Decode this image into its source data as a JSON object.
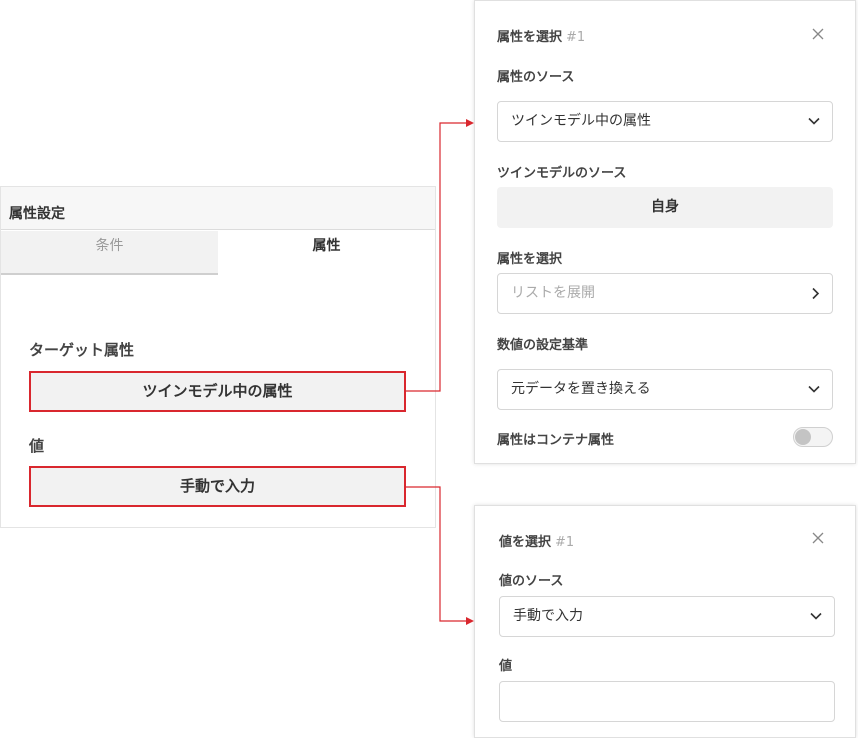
{
  "left": {
    "header": "属性設定",
    "tabs": [
      {
        "label": "条件",
        "active": false
      },
      {
        "label": "属性",
        "active": true
      }
    ],
    "target_label": "ターゲット属性",
    "target_value": "ツインモデル中の属性",
    "value_label": "値",
    "value_value": "手動で入力"
  },
  "attr_dialog": {
    "title": "属性を選択",
    "number": "#1",
    "source_label": "属性のソース",
    "source_value": "ツインモデル中の属性",
    "twin_source_label": "ツインモデルのソース",
    "twin_source_value": "自身",
    "select_attr_label": "属性を選択",
    "select_attr_placeholder": "リストを展開",
    "basis_label": "数値の設定基準",
    "basis_value": "元データを置き換える",
    "container_label": "属性はコンテナ属性",
    "container_toggle_on": false
  },
  "value_dialog": {
    "title": "値を選択",
    "number": "#1",
    "source_label": "値のソース",
    "source_value": "手動で入力",
    "value_label": "値",
    "value_input": ""
  },
  "colors": {
    "highlight": "#d9272e",
    "panel_bg": "#f2f2f2"
  },
  "icons": {
    "close": "close-icon",
    "dropdown": "chevron-down-icon",
    "expand": "chevron-right-icon"
  }
}
